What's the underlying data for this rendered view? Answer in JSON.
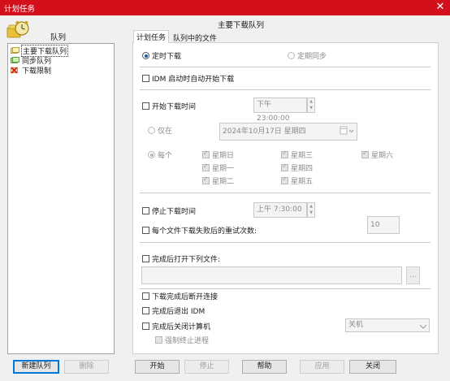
{
  "window": {
    "title": "计划任务",
    "close_glyph": "✕"
  },
  "queues": {
    "title": "队列",
    "items": [
      {
        "label": "主要下载队列",
        "icon": "queue-main-icon",
        "selected": true
      },
      {
        "label": "同步队列",
        "icon": "queue-sync-icon",
        "selected": false
      },
      {
        "label": "下载限制",
        "icon": "download-limit-icon",
        "selected": false
      }
    ],
    "new_button": "新建队列",
    "delete_button": "删除"
  },
  "pane": {
    "title": "主要下载队列",
    "tabs": [
      {
        "label": "计划任务",
        "active": true
      },
      {
        "label": "队列中的文件",
        "active": false
      }
    ]
  },
  "schedule": {
    "timed_download": "定时下载",
    "periodic_sync": "定期同步",
    "start_on_idm": "IDM 启动时自动开始下载",
    "start_time_label": "开始下载时间",
    "start_time_value": "下午 23:00:00",
    "only_on": "仅在",
    "date_value": "2024年10月17日 星期四",
    "every": "每个",
    "days": [
      "星期日",
      "星期一",
      "星期二",
      "星期三",
      "星期四",
      "星期五",
      "星期六"
    ],
    "stop_time_label": "停止下载时间",
    "stop_time_value": "上午   7:30:00",
    "retry_label": "每个文件下载失败后的重试次数:",
    "retry_value": "10",
    "open_after_label": "完成后打开下列文件:",
    "open_after_value": "",
    "browse_button": "...",
    "disconnect": "下载完成后断开连接",
    "exit_idm": "完成后退出 IDM",
    "shutdown": "完成后关闭计算机",
    "shutdown_option": "关机",
    "force_kill": "强制终止进程"
  },
  "footer": {
    "start": "开始",
    "stop": "停止",
    "help": "帮助",
    "apply": "应用",
    "close": "关闭"
  },
  "colors": {
    "title_bar": "#d40f1c",
    "accent": "#0078d7"
  }
}
